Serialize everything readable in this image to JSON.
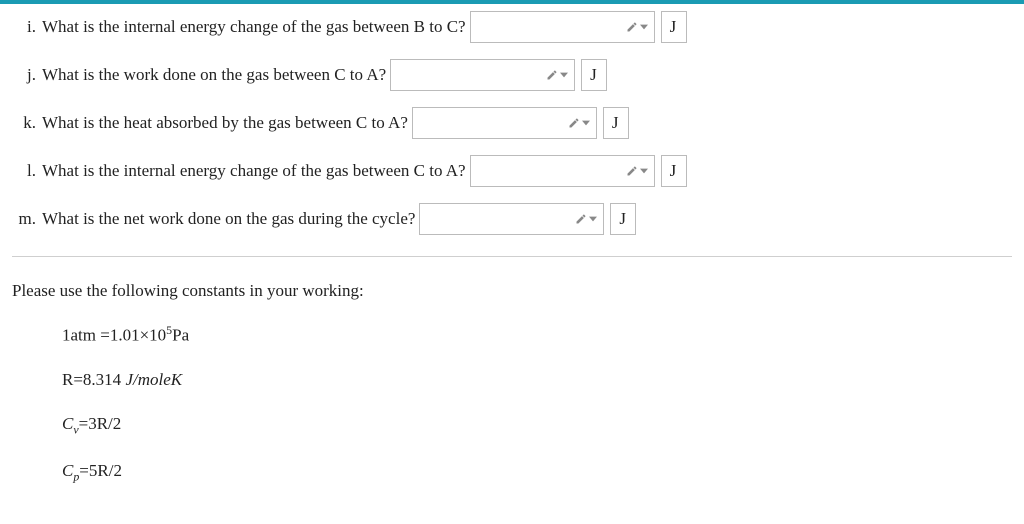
{
  "questions": {
    "i": {
      "marker": "i.",
      "text": "What is the internal energy change of the gas between B to C?",
      "unit": "J"
    },
    "j": {
      "marker": "j.",
      "text": "What is the work done on the gas between C to A?",
      "unit": "J"
    },
    "k": {
      "marker": "k.",
      "text": "What is the heat absorbed by the gas between C to A?",
      "unit": "J"
    },
    "l": {
      "marker": "l.",
      "text": "What is the internal energy change of the gas between C to A?",
      "unit": "J"
    },
    "m": {
      "marker": "m.",
      "text": "What is the net work done on the gas during the cycle?",
      "unit": "J"
    }
  },
  "constants": {
    "header": "Please use the following constants in your working:",
    "atm_label": "1atm =1.01×10",
    "atm_exp": "5",
    "atm_unit": "Pa",
    "R_label": "R=8.314 ",
    "R_unit": "J/moleK",
    "cv_prefix": "C",
    "cv_sub": "v",
    "cv_val": "=3R/2",
    "cp_prefix": "C",
    "cp_sub": "p",
    "cp_val": "=5R/2"
  },
  "icons": {
    "pencil": "pencil-dropdown-icon"
  }
}
